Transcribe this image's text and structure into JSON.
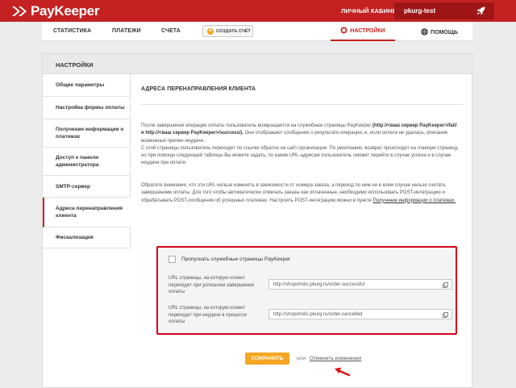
{
  "brand": {
    "name": "PayKeeper",
    "accent": "#c42222",
    "highlight": "#f5a623",
    "icon": "double-chevron-logo-icon"
  },
  "header": {
    "cabinet_label": "ЛИЧНЫЙ КАБИНЕТ:",
    "username": "pkurg-test",
    "user_icon": "rocket-icon"
  },
  "nav": {
    "items": [
      "СТАТИСТИКА",
      "ПЛАТЕЖИ",
      "СЧЕТА"
    ],
    "create_invoice": "СОЗДАТЬ СЧЁТ",
    "settings": "НАСТРОЙКИ",
    "help": "ПОМОЩЬ"
  },
  "panel": {
    "title": "НАСТРОЙКИ"
  },
  "sidebar": {
    "items": [
      {
        "label": "Общие параметры",
        "active": false
      },
      {
        "label": "Настройка формы оплаты",
        "active": false
      },
      {
        "label": "Получение информации о платежах",
        "active": false
      },
      {
        "label": "Доступ к панели администратора",
        "active": false
      },
      {
        "label": "SMTP-сервер",
        "active": false
      },
      {
        "label": "Адреса перенаправления клиента",
        "active": true
      },
      {
        "label": "Фискализация",
        "active": false
      }
    ]
  },
  "content": {
    "title": "АДРЕСА ПЕРЕНАПРАВЛЕНИЯ КЛИЕНТА",
    "p1_a": "После завершения операции оплаты пользователь возвращается на служебные страницы PayKeeper",
    "p1_b": "(http://<ваш сервер PayKeeper>/fail/ и http://<ваш сервер PayKeeper>/success/).",
    "p1_c": "Они отображают сообщение о результате операции, и, если оплата не удалась, описание возможных причин неудачи.",
    "p1_d": "С этой страницы пользователь переходит по ссылке обратно на сайт организации. По умолчанию, возврат происходит на главную страницу, но при помощи следующей таблицы Вы можете задать, по каким URL-адресам пользователь сможет перейти в случае успеха и в случае неудачи при оплате.",
    "p2": "Обратите внимание, что эти URL нельзя изменять в зависимости от номера заказа, а переход по ним ни в коем случае нельзя считать завершением оплаты. Для того чтобы автоматически отмечать заказы как оплаченные, необходимо использовать POST-интеграцию и обрабатывать POST-сообщения об успешных платежах. Настроить POST-интеграцию можно в пункте",
    "p2_link": "Получение информации о платежах."
  },
  "form": {
    "skip_label": "Пропускать служебные страницы PayKeeper",
    "skip_checked": false,
    "success_label": "URL страницы, на которую клиент переходит при успешном завершении оплаты",
    "success_value": "http://shopoholic.pkurg.ru/order-successful",
    "fail_label": "URL страницы, на которую клиент переходит при неудаче в процессе оплаты",
    "fail_value": "http://shopoholic.pkurg.ru/order-cancelled"
  },
  "actions": {
    "save": "СОХРАНИТЬ",
    "or": "или",
    "cancel": "Отменить изменения"
  }
}
